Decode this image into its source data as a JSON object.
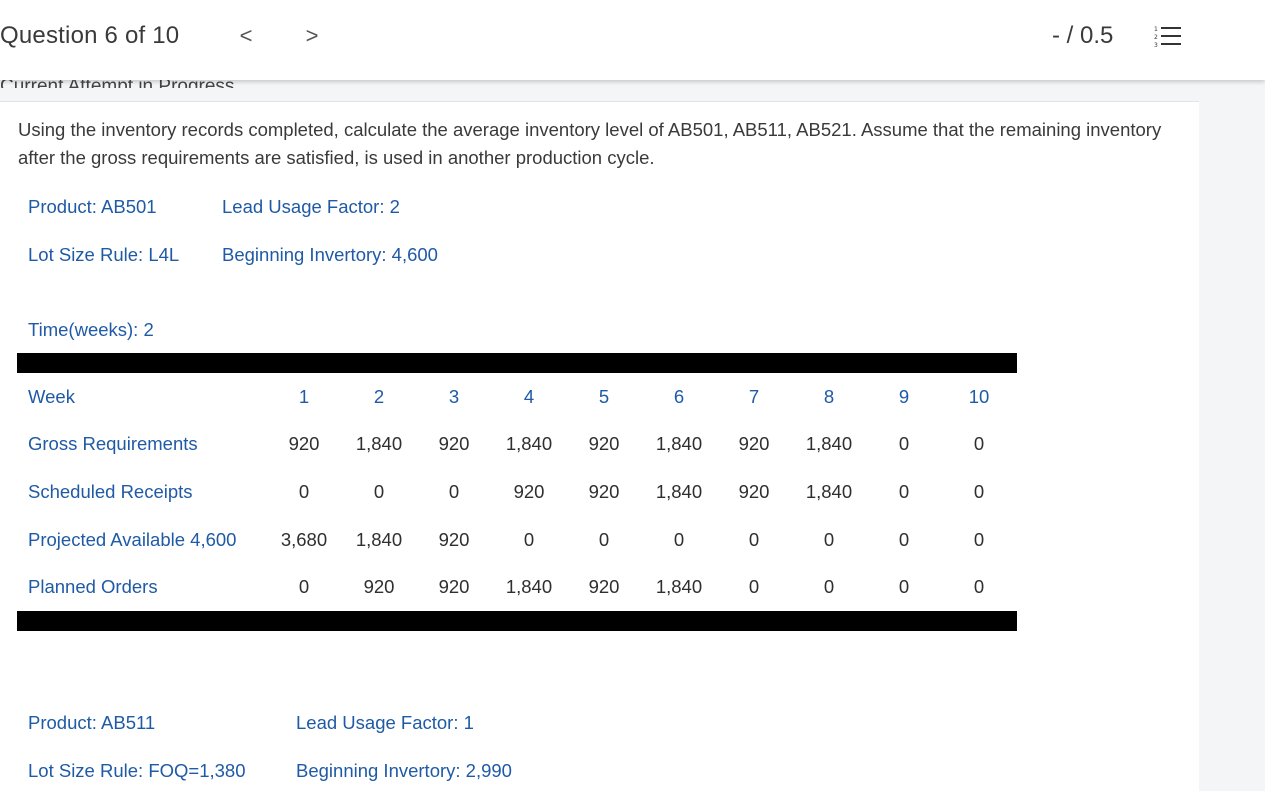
{
  "header": {
    "question_counter": "Question 6 of 10",
    "prev_label": "<",
    "next_label": ">",
    "score": "- / 0.5",
    "list_icon": "question-list-icon",
    "attempt_status": "Current Attempt in Progress"
  },
  "question": {
    "text": "Using the inventory records completed, calculate the average inventory level of AB501, AB511, AB521. Assume that the remaining inventory after the gross requirements are satisfied, is used in another production cycle."
  },
  "product1": {
    "product": "Product: AB501",
    "lead_usage": "Lead Usage Factor: 2",
    "lot_size": "Lot Size Rule: L4L",
    "beginning": "Beginning Invertory: 4,600",
    "time": "Time(weeks): 2",
    "table": {
      "week_label": "Week",
      "weeks": [
        "1",
        "2",
        "3",
        "4",
        "5",
        "6",
        "7",
        "8",
        "9",
        "10"
      ],
      "gross_label": "Gross Requirements",
      "gross": [
        "920",
        "1,840",
        "920",
        "1,840",
        "920",
        "1,840",
        "920",
        "1,840",
        "0",
        "0"
      ],
      "sched_label": "Scheduled Receipts",
      "sched": [
        "0",
        "0",
        "0",
        "920",
        "920",
        "1,840",
        "920",
        "1,840",
        "0",
        "0"
      ],
      "proj_label": "Projected Available 4,600",
      "proj": [
        "3,680",
        "1,840",
        "920",
        "0",
        "0",
        "0",
        "0",
        "0",
        "0",
        "0"
      ],
      "planned_label": "Planned Orders",
      "planned": [
        "0",
        "920",
        "920",
        "1,840",
        "920",
        "1,840",
        "0",
        "0",
        "0",
        "0"
      ]
    }
  },
  "product2": {
    "product": "Product: AB511",
    "lead_usage": "Lead Usage Factor: 1",
    "lot_size": "Lot Size Rule: FOQ=1,380",
    "beginning": "Beginning Invertory: 2,990"
  },
  "colors": {
    "label_blue": "#1f5aa6",
    "bar_black": "#000000"
  }
}
